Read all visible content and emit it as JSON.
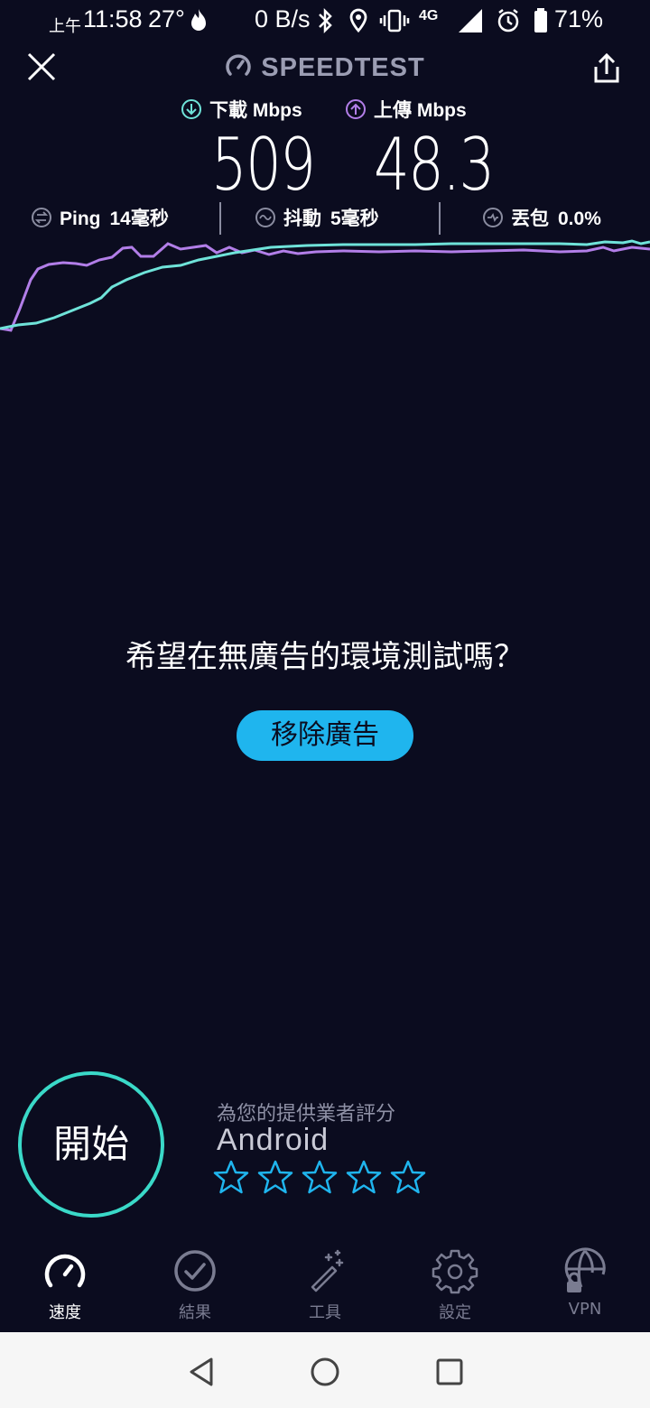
{
  "status_bar": {
    "ampm": "上午",
    "time": "11:58",
    "temp": "27°",
    "net_speed": "0 B/s",
    "network": "4G",
    "battery": "71%"
  },
  "header": {
    "title": "SPEEDTEST"
  },
  "results": {
    "download_label": "下載 Mbps",
    "download_value": "509",
    "upload_label": "上傳 Mbps",
    "upload_value": "48.3",
    "ping_label": "Ping",
    "ping_value": "14毫秒",
    "jitter_label": "抖動",
    "jitter_value": "5毫秒",
    "loss_label": "丟包",
    "loss_value": "0.0%"
  },
  "colors": {
    "download": "#6fe3d9",
    "upload": "#b27ee8",
    "accent": "#1fb5ee",
    "start_ring": "#3ad9c8"
  },
  "ad": {
    "prompt": "希望在無廣告的環境測試嗎？",
    "button": "移除廣告"
  },
  "start": {
    "label": "開始"
  },
  "rating": {
    "label": "為您的提供業者評分",
    "provider": "Android",
    "stars": 0
  },
  "nav": {
    "items": [
      {
        "label": "速度",
        "icon": "speedometer-icon",
        "active": true
      },
      {
        "label": "結果",
        "icon": "check-circle-icon",
        "active": false
      },
      {
        "label": "工具",
        "icon": "magic-wand-icon",
        "active": false
      },
      {
        "label": "設定",
        "icon": "gear-icon",
        "active": false
      },
      {
        "label": "VPN",
        "icon": "vpn-globe-lock-icon",
        "active": false
      }
    ]
  },
  "system_nav": {
    "back": "back-icon",
    "home": "home-icon",
    "recents": "recents-icon"
  }
}
